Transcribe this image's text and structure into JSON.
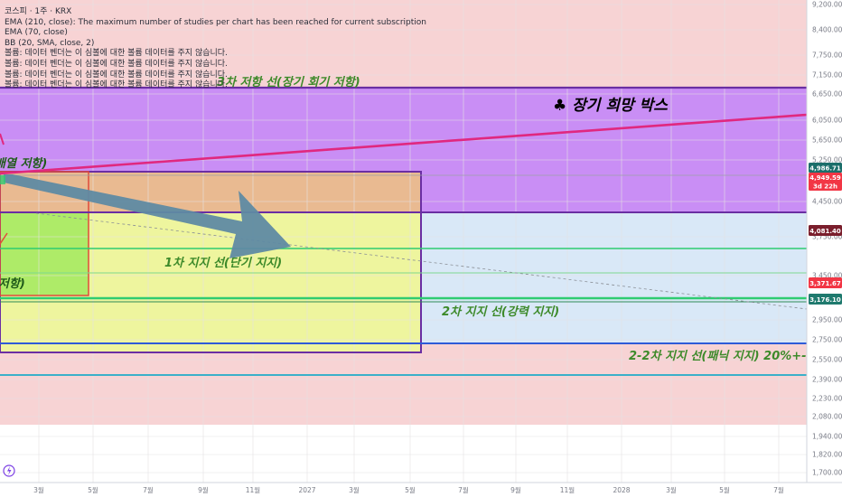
{
  "legend": {
    "symbol": "코스피 · 1주 · KRX",
    "ema210": "EMA (210, close): The maximum number of studies per chart has been reached for current subscription",
    "ema70": "EMA (70, close)",
    "bb": "BB (20, SMA, close, 2)",
    "volume_notes": [
      "볼륨: 데이터 벤더는 이 심볼에 대한 볼륨 데이터를 주지 않습니다.",
      "볼륨: 데이터 벤더는 이 심볼에 대한 볼륨 데이터를 주지 않습니다.",
      "볼륨: 데이터 벤더는 이 심볼에 대한 볼륨 데이터를 주지 않습니다.",
      "볼륨: 데이터 벤더는 이 심볼에 대한 볼륨 데이터를 주지 않습니다."
    ]
  },
  "annotations": {
    "resist3": "3차 저항 선(장기 회기 저항)",
    "hope_box": "♣ 장기 희망 박스",
    "left_resist_top": "배열 저항)",
    "support1": "1차 지지 선(단기 지지)",
    "left_resist_low": "저항)",
    "support2": "2차 지지 선(강력 지지)",
    "support22": "2-2차 지지 선(패닉 지지) 20%+-"
  },
  "badges": {
    "last_price": "4,986.71",
    "ema_price": "4,949.59",
    "countdown": "3d 22h",
    "level1": "4,081.40",
    "level2": "3,371.67",
    "level3": "3,176.10"
  },
  "colors": {
    "background": "#ffffff",
    "pink_zone": "#f7d3d4",
    "purple_box": "#c98ef5",
    "purple_line": "#6a2ea3",
    "trend_line": "#e0287f",
    "blue_zone": "#d9e8f7",
    "yellow_zone": "#eef59e",
    "green_zone": "#9ee85a",
    "orange_box": "#e8b48f",
    "arrow": "#5f8aa3",
    "green_line": "#2ecc71",
    "blue_line": "#2e5bd8",
    "cyan_line": "#3ab0c9",
    "badge_teal": "#1b6e6a",
    "badge_red": "#f23645",
    "badge_maroon": "#7a1e2c",
    "badge_teal2": "#1f7a6e"
  },
  "chart_data": {
    "type": "line",
    "title": "코스피 · 1주 · KRX",
    "x_ticks": [
      "3월",
      "5월",
      "7월",
      "9월",
      "11월",
      "2027",
      "3월",
      "5월",
      "7월",
      "9월",
      "11월",
      "2028",
      "3월",
      "5월",
      "7월"
    ],
    "y_ticks": [
      9200,
      8400,
      7750,
      7150,
      6650,
      6050,
      5650,
      5250,
      4450,
      3750,
      3450,
      2950,
      2750,
      2550,
      2390,
      2230,
      2080,
      1940,
      1820,
      1700
    ],
    "y_scale": "log",
    "ylim": [
      1650,
      9300
    ],
    "horizontal_levels": [
      {
        "label": "3차 저항 선(장기 회기 저항)",
        "value": 6800
      },
      {
        "label": "1차 지지 선(단기 지지)",
        "value": 3800
      },
      {
        "label": "2차 지지 선(강력 지지)",
        "value": 3176.1
      },
      {
        "label": "2-2차 지지 선(패닉 지지) 20%+-",
        "value": 2700
      },
      {
        "value": 4370
      },
      {
        "value": 4986.71
      },
      {
        "value": 3230
      },
      {
        "value": 3480
      },
      {
        "value": 2430
      }
    ],
    "zones": [
      {
        "label": "♣ 장기 희망 박스",
        "from": 4370,
        "to": 6800
      }
    ],
    "trend_line": {
      "start": 4986.71,
      "end": 6100
    },
    "last_price": 4986.71,
    "grid": true
  }
}
